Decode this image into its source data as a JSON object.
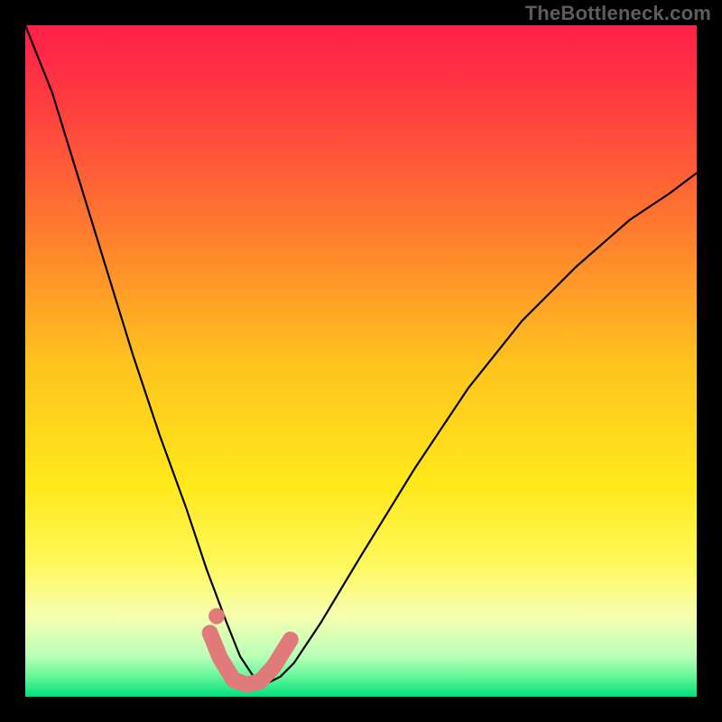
{
  "watermark": {
    "text": "TheBottleneck.com"
  },
  "chart_data": {
    "type": "line",
    "title": "",
    "subtitle": "",
    "xlabel": "",
    "ylabel": "",
    "xlim": [
      0,
      100
    ],
    "ylim": [
      0,
      100
    ],
    "grid": false,
    "legend": false,
    "annotations": [],
    "background_gradient_stops": [
      {
        "pos": 0.0,
        "color": "#ff1f4a"
      },
      {
        "pos": 0.12,
        "color": "#ff3d3f"
      },
      {
        "pos": 0.3,
        "color": "#ff7a2f"
      },
      {
        "pos": 0.5,
        "color": "#ffc21f"
      },
      {
        "pos": 0.68,
        "color": "#ffe81a"
      },
      {
        "pos": 0.8,
        "color": "#fff85a"
      },
      {
        "pos": 0.88,
        "color": "#f7ffb0"
      },
      {
        "pos": 0.94,
        "color": "#b8ffb8"
      },
      {
        "pos": 0.97,
        "color": "#66f59a"
      },
      {
        "pos": 1.0,
        "color": "#00e27a"
      }
    ],
    "series": [
      {
        "name": "bottleneck-curve",
        "color": "#000000",
        "x": [
          0,
          4,
          8,
          12,
          16,
          20,
          24,
          27,
          30,
          32,
          34,
          36,
          38,
          40,
          44,
          50,
          58,
          66,
          74,
          82,
          90,
          96,
          100
        ],
        "values": [
          100,
          90,
          77,
          64,
          51,
          39,
          28,
          19,
          11,
          6,
          3,
          2,
          3,
          5,
          11,
          21,
          34,
          46,
          56,
          64,
          71,
          75,
          78
        ]
      }
    ],
    "highlight_band": {
      "name": "bottom-coral-band",
      "color": "#e17a7a",
      "x": [
        27.5,
        29,
        31,
        33,
        35,
        37,
        39.5
      ],
      "values": [
        9.5,
        5.8,
        2.5,
        1.8,
        2.3,
        4.5,
        8.5
      ]
    },
    "highlight_dot": {
      "x": 28.5,
      "y": 12,
      "r": 1.2,
      "color": "#e17a7a"
    }
  }
}
